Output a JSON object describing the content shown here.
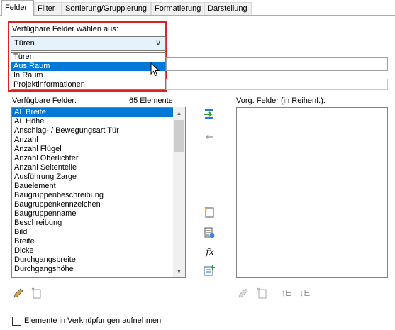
{
  "tabs": [
    "Felder",
    "Filter",
    "Sortierung/Gruppierung",
    "Formatierung",
    "Darstellung"
  ],
  "fields_from_label": "Verfügbare Felder wählen aus:",
  "fields_from_value": "Türen",
  "fields_from_options": [
    "Türen",
    "Aus Raum",
    "In Raum",
    "Projektinformationen"
  ],
  "fields_from_selected_index": 1,
  "available_fields_label": "Verfügbare Felder:",
  "available_count": "65 Elemente",
  "available_fields": [
    "AL Breite",
    "AL Höhe",
    "Anschlag- / Bewegungsart Tür",
    "Anzahl",
    "Anzahl Flügel",
    "Anzahl Oberlichter",
    "Anzahl Seitenteile",
    "Ausführung Zarge",
    "Bauelement",
    "Baugruppenbeschreibung",
    "Baugruppenkennzeichen",
    "Baugruppenname",
    "Beschreibung",
    "Bild",
    "Breite",
    "Dicke",
    "Durchgangsbreite",
    "Durchgangshöhe"
  ],
  "available_selected_index": 0,
  "scheduled_fields_label": "Vorg. Felder (in Reihenf.):",
  "scheduled_fields": [],
  "checkbox_label": "Elemente in Verknüpfungen aufnehmen",
  "checkbox_checked": false,
  "colors": {
    "accent": "#0078d7",
    "highlight_frame": "#e02020"
  }
}
